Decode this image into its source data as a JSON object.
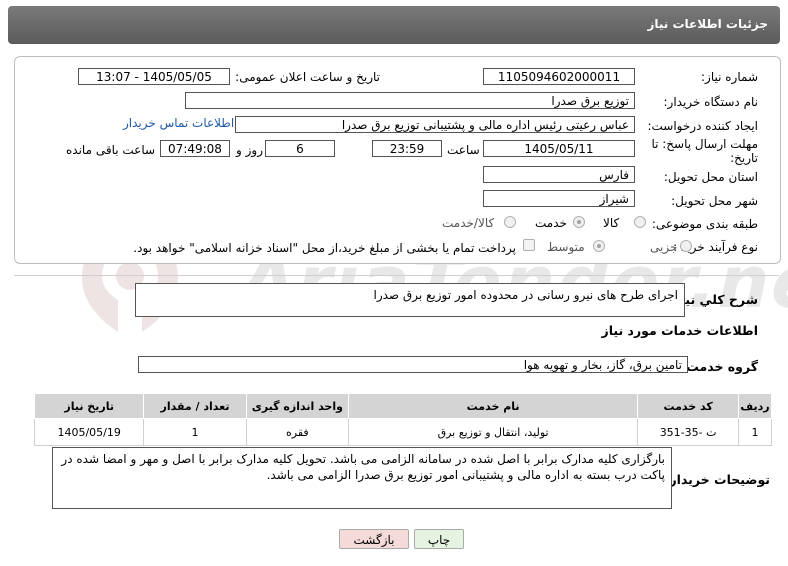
{
  "header": {
    "title": "جزئیات اطلاعات نیاز"
  },
  "form": {
    "need_number": {
      "label": "شماره نیاز:",
      "value": "1105094602000011"
    },
    "announce": {
      "label": "تاریخ و ساعت اعلان عمومی:",
      "value": "1405/05/05 - 13:07"
    },
    "buyer_org": {
      "label": "نام دستگاه خریدار:",
      "value": "توزیع برق صدرا"
    },
    "requester": {
      "label": "ایجاد کننده درخواست:",
      "value": "عباس رعیتی رئیس اداره مالی و پشتیبانی توزیع برق صدرا",
      "contact_link": "اطلاعات تماس خریدار"
    },
    "deadline": {
      "label": "مهلت ارسال پاسخ: تا تاریخ:",
      "date": "1405/05/11",
      "time_label": "ساعت",
      "time": "23:59",
      "days": "6",
      "days_label": "روز و",
      "remaining": "07:49:08",
      "remaining_label": "ساعت باقی مانده"
    },
    "province": {
      "label": "استان محل تحویل:",
      "value": "فارس"
    },
    "city": {
      "label": "شهر محل تحویل:",
      "value": "شیراز"
    },
    "category": {
      "label": "طبقه بندی موضوعی:",
      "options": [
        "کالا",
        "خدمت",
        "کالا/خدمت"
      ],
      "selected": "خدمت"
    },
    "purchase_type": {
      "label": "نوع فرآیند خرید :",
      "options": [
        "جزیی",
        "متوسط"
      ],
      "selected": "متوسط",
      "note": "پرداخت تمام یا بخشی از مبلغ خرید،از محل \"اسناد خزانه اسلامی\" خواهد بود."
    }
  },
  "summary": {
    "label": "شرح كلي نياز:",
    "value": "اجرای طرح های نیرو رسانی در محدوده امور توزیع برق صدرا"
  },
  "services_section": {
    "title": "اطلاعات خدمات مورد نیاز"
  },
  "service_group": {
    "label": "گروه خدمت:",
    "value": "تامین برق، گاز، بخار و تهویه هوا"
  },
  "table": {
    "headers": [
      "ردیف",
      "کد خدمت",
      "نام خدمت",
      "واحد اندازه گیری",
      "تعداد / مقدار",
      "تاریخ نیاز"
    ],
    "rows": [
      [
        "1",
        "ت -35-351",
        "تولید، انتقال و توزیع برق",
        "فقره",
        "1",
        "1405/05/19"
      ]
    ]
  },
  "buyer_notes": {
    "label": "توضیحات خریدار:",
    "value": "بارگزاری کلیه مدارک برابر با اصل شده در سامانه الزامی می باشد. تحویل کلیه مدارک برابر با اصل و مهر و امضا شده در پاکت درب بسته به اداره مالی و پشتیبانی امور توزیع برق صدرا الزامی می باشد."
  },
  "buttons": {
    "print": "چاپ",
    "back": "بازگشت"
  },
  "colors": {
    "header_bg": "#666666",
    "link": "#1f5aa8",
    "back_btn_bg": "#f5dada",
    "print_btn_bg": "#e6f3e0",
    "table_header_bg": "#d4d4d4"
  },
  "watermark": {
    "text": "AriaTender.neT"
  }
}
